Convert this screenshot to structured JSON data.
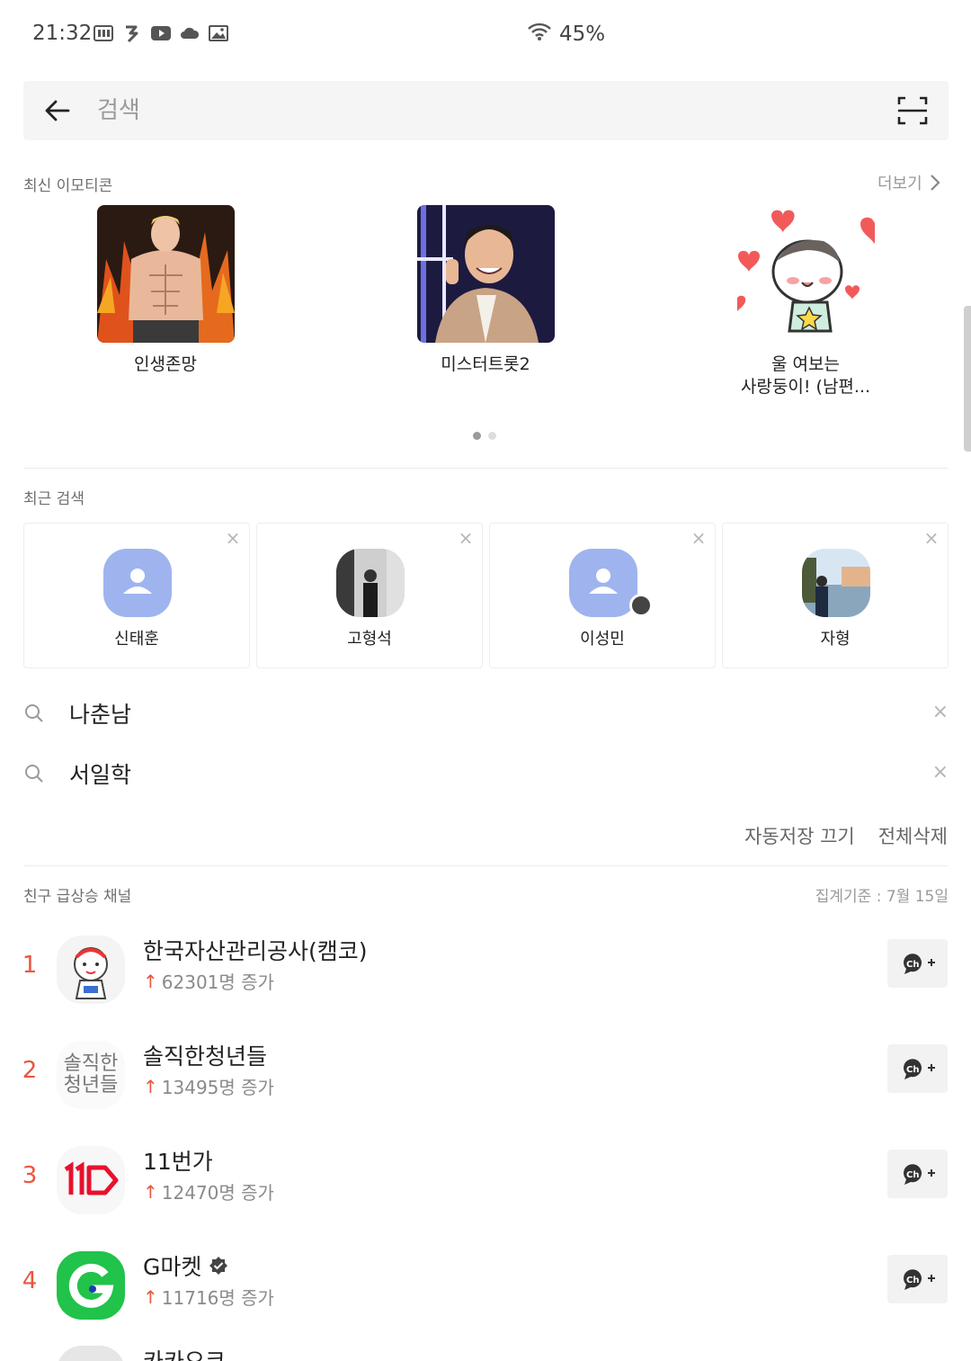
{
  "status_bar": {
    "time": "21:32",
    "battery": "45%"
  },
  "search": {
    "placeholder": "검색"
  },
  "emoticons": {
    "title": "최신 이모티콘",
    "more_label": "더보기",
    "items": [
      {
        "label": "인생존망"
      },
      {
        "label": "미스터트롯2"
      },
      {
        "label_line1": "울 여보는",
        "label_line2": "사랑둥이! (남편..."
      }
    ]
  },
  "recent": {
    "title": "최근 검색",
    "profiles": [
      {
        "name": "신태훈"
      },
      {
        "name": "고형석"
      },
      {
        "name": "이성민"
      },
      {
        "name": "자형"
      }
    ],
    "queries": [
      {
        "text": "나춘남"
      },
      {
        "text": "서일학"
      }
    ],
    "autosave_off_label": "자동저장 끄기",
    "delete_all_label": "전체삭제"
  },
  "trending": {
    "title": "친구 급상승 채널",
    "basis": "집계기준 : 7월 15일",
    "channels": [
      {
        "rank": "1",
        "name": "한국자산관리공사(캠코)",
        "increase": "62301명 증가"
      },
      {
        "rank": "2",
        "name": "솔직한청년들",
        "increase": "13495명 증가",
        "logo_text_line1": "솔직한",
        "logo_text_line2": "청년들"
      },
      {
        "rank": "3",
        "name": "11번가",
        "increase": "12470명 증가"
      },
      {
        "rank": "4",
        "name": "G마켓",
        "increase": "11716명 증가"
      },
      {
        "name": "카카오코"
      }
    ]
  },
  "colors": {
    "accent": "#e8573f",
    "avatar_default": "#9fb4ee",
    "gmarket": "#21c34a"
  }
}
